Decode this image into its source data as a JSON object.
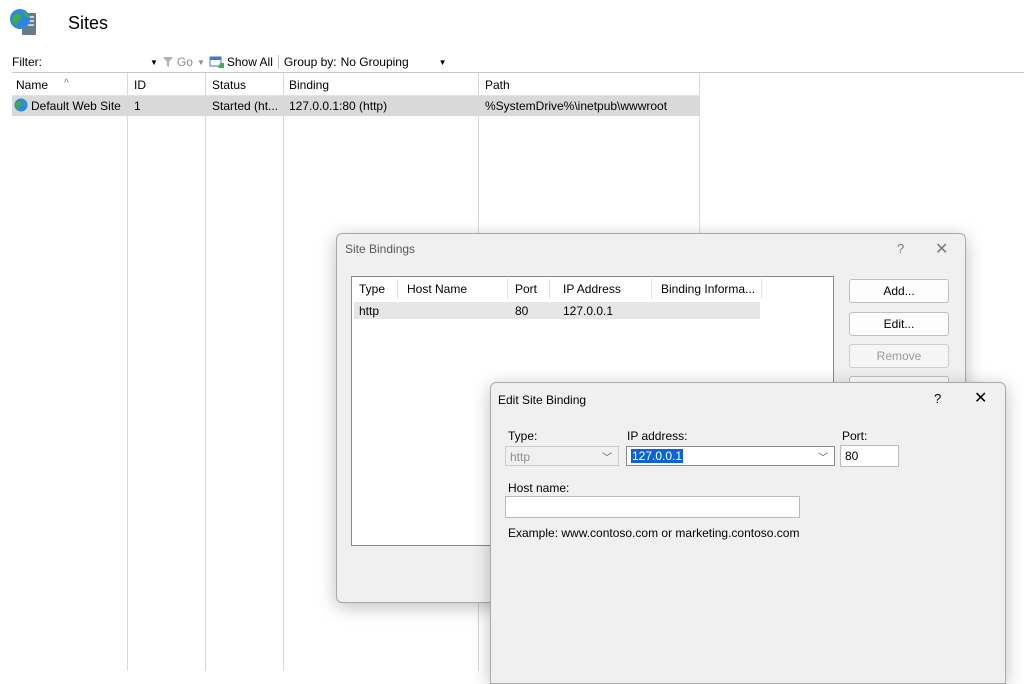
{
  "header": {
    "title": "Sites",
    "icon": "sites-globe-icon"
  },
  "toolbar": {
    "filter_label": "Filter:",
    "go_label": "Go",
    "show_all_label": "Show All",
    "group_by_label": "Group by:",
    "group_by_value": "No Grouping"
  },
  "sites_table": {
    "columns": [
      "Name",
      "ID",
      "Status",
      "Binding",
      "Path"
    ],
    "rows": [
      {
        "name": "Default Web Site",
        "id": "1",
        "status": "Started (ht...",
        "binding": "127.0.0.1:80 (http)",
        "path": "%SystemDrive%\\inetpub\\wwwroot"
      }
    ]
  },
  "site_bindings": {
    "title": "Site Bindings",
    "help": "?",
    "close": "✕",
    "columns": [
      "Type",
      "Host Name",
      "Port",
      "IP Address",
      "Binding Informa..."
    ],
    "rows": [
      {
        "type": "http",
        "host": "",
        "port": "80",
        "ip": "127.0.0.1",
        "info": ""
      }
    ],
    "buttons": {
      "add": "Add...",
      "edit": "Edit...",
      "remove": "Remove"
    }
  },
  "edit_binding": {
    "title": "Edit Site Binding",
    "help": "?",
    "close": "✕",
    "type_label": "Type:",
    "type_value": "http",
    "ip_label": "IP address:",
    "ip_value": "127.0.0.1",
    "port_label": "Port:",
    "port_value": "80",
    "host_label": "Host name:",
    "host_value": "",
    "example": "Example: www.contoso.com or marketing.contoso.com"
  },
  "colors": {
    "accent": "#0a64d8",
    "row_selected": "#d9d9d9",
    "dialog_bg": "#f0f0f0"
  }
}
